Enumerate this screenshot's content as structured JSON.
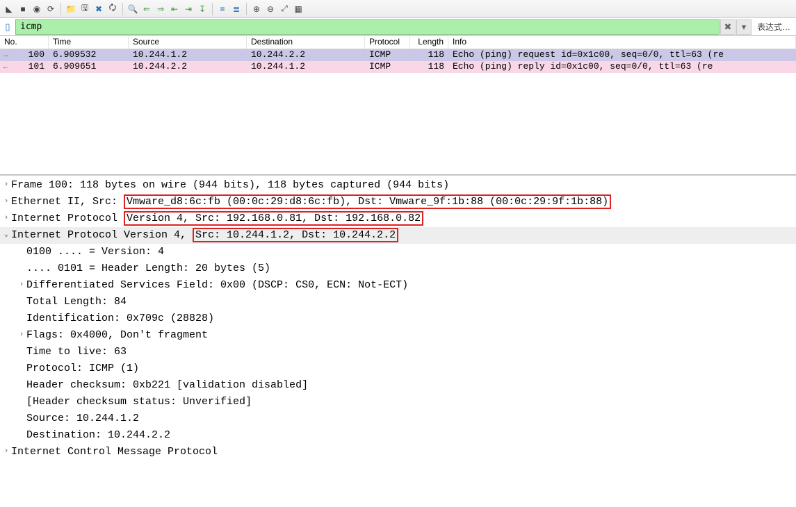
{
  "filter": {
    "value": "icmp",
    "expression_label": "表达式…"
  },
  "columns": {
    "no": "No.",
    "time": "Time",
    "source": "Source",
    "destination": "Destination",
    "protocol": "Protocol",
    "length": "Length",
    "info": "Info"
  },
  "packets": [
    {
      "arrow": "→",
      "no": "100",
      "time": "6.909532",
      "source": "10.244.1.2",
      "destination": "10.244.2.2",
      "protocol": "ICMP",
      "length": "118",
      "info": "Echo (ping) request  id=0x1c00, seq=0/0, ttl=63 (re",
      "class": "sel"
    },
    {
      "arrow": "←",
      "no": "101",
      "time": "6.909651",
      "source": "10.244.2.2",
      "destination": "10.244.1.2",
      "protocol": "ICMP",
      "length": "118",
      "info": "Echo (ping) reply    id=0x1c00, seq=0/0, ttl=63 (re",
      "class": "pink"
    }
  ],
  "tree": {
    "frame": "Frame 100: 118 bytes on wire (944 bits), 118 bytes captured (944 bits)",
    "eth_prefix": "Ethernet II, Src: ",
    "eth_boxed": "Vmware_d8:6c:fb (00:0c:29:d8:6c:fb), Dst: Vmware_9f:1b:88 (00:0c:29:9f:1b:88)",
    "ip_outer_prefix": "Internet Protocol ",
    "ip_outer_boxed": "Version 4, Src: 192.168.0.81, Dst: 192.168.0.82",
    "ip_inner_prefix": "Internet Protocol Version 4, ",
    "ip_inner_boxed": "Src: 10.244.1.2, Dst: 10.244.2.2",
    "ip_fields": [
      "0100 .... = Version: 4",
      ".... 0101 = Header Length: 20 bytes (5)",
      "Differentiated Services Field: 0x00 (DSCP: CS0, ECN: Not-ECT)",
      "Total Length: 84",
      "Identification: 0x709c (28828)",
      "Flags: 0x4000, Don't fragment",
      "Time to live: 63",
      "Protocol: ICMP (1)",
      "Header checksum: 0xb221 [validation disabled]",
      "[Header checksum status: Unverified]",
      "Source: 10.244.1.2",
      "Destination: 10.244.2.2"
    ],
    "ip_field_expand": [
      false,
      false,
      true,
      false,
      false,
      true,
      false,
      false,
      false,
      false,
      false,
      false
    ],
    "icmp": "Internet Control Message Protocol"
  },
  "toolbar_icons": [
    "◣",
    "■",
    "◉",
    "⟳",
    "|",
    "📁",
    "🖫",
    "✖",
    "🗘",
    "|",
    "🔍",
    "⇐",
    "⇒",
    "⇤",
    "⇥",
    "↧",
    "|",
    "≡",
    "≣",
    "|",
    "⊕",
    "⊖",
    "⤢",
    "▦"
  ]
}
